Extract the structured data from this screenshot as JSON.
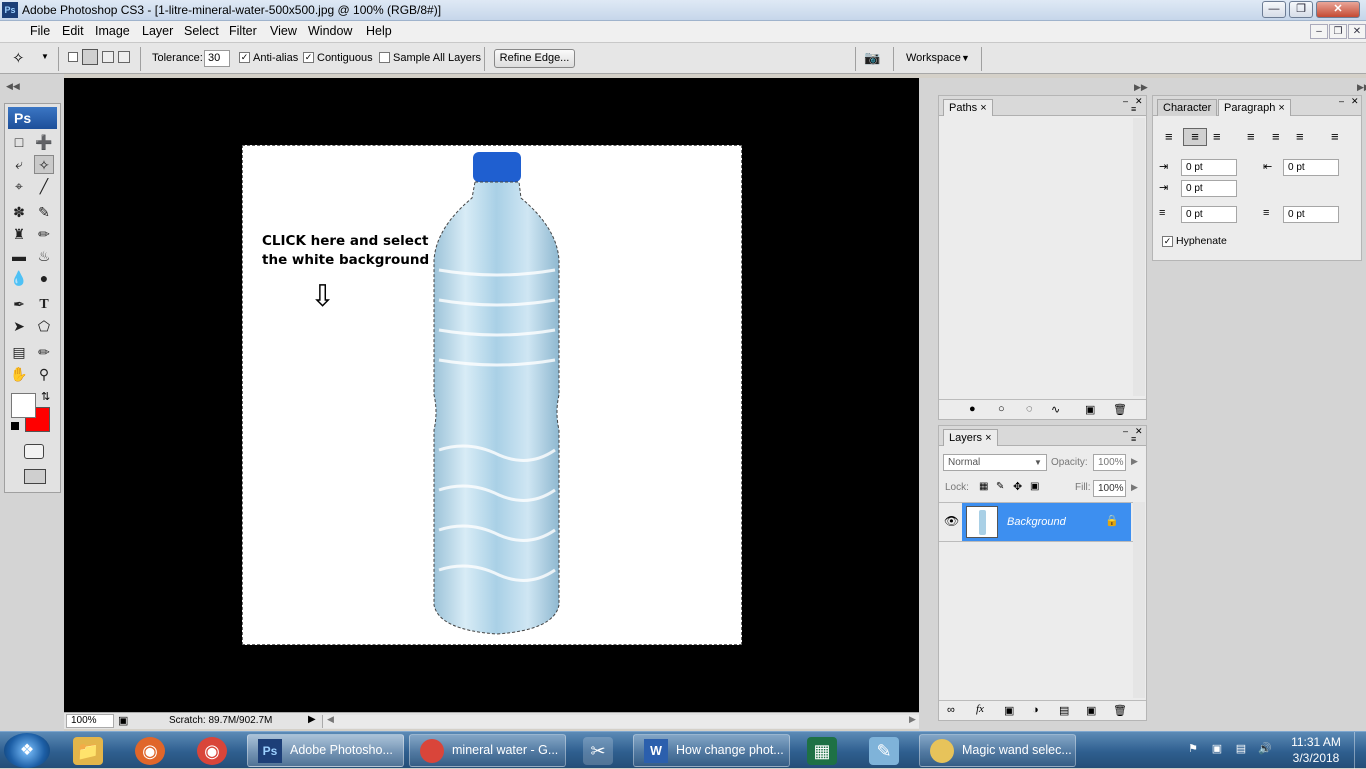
{
  "window": {
    "title": "Adobe Photoshop CS3 - [1-litre-mineral-water-500x500.jpg @ 100% (RGB/8#)]"
  },
  "menu": [
    "File",
    "Edit",
    "Image",
    "Layer",
    "Select",
    "Filter",
    "View",
    "Window",
    "Help"
  ],
  "options": {
    "tolerance_label": "Tolerance:",
    "tolerance_value": "30",
    "anti_alias": "Anti-alias",
    "contiguous": "Contiguous",
    "sample_all": "Sample All Layers",
    "refine_edge": "Refine Edge...",
    "workspace": "Workspace"
  },
  "tools_logo": "Ps",
  "canvas": {
    "annotation_line1": "CLICK here and select",
    "annotation_line2": "the white background",
    "arrow": "⇩"
  },
  "status": {
    "zoom": "100%",
    "scratch": "Scratch: 89.7M/902.7M"
  },
  "paths_panel": {
    "tab": "Paths"
  },
  "paragraph_panel": {
    "tab_character": "Character",
    "tab_paragraph": "Paragraph",
    "indent_left": "0 pt",
    "indent_right": "0 pt",
    "indent_first": "0 pt",
    "space_before": "0 pt",
    "space_after": "0 pt",
    "hyphenate": "Hyphenate"
  },
  "layers_panel": {
    "tab": "Layers",
    "blend_mode": "Normal",
    "opacity_label": "Opacity:",
    "opacity_value": "100%",
    "lock_label": "Lock:",
    "fill_label": "Fill:",
    "fill_value": "100%",
    "layer_name": "Background"
  },
  "taskbar": {
    "photoshop": "Adobe Photosho...",
    "chrome_window": "mineral water - G...",
    "word_window": "How change phot...",
    "magic_window": "Magic wand selec...",
    "time": "11:31 AM",
    "date": "3/3/2018"
  },
  "colors": {
    "foreground": "#ffffff",
    "background": "#ff0000",
    "layer_highlight": "#3d8ff0"
  }
}
